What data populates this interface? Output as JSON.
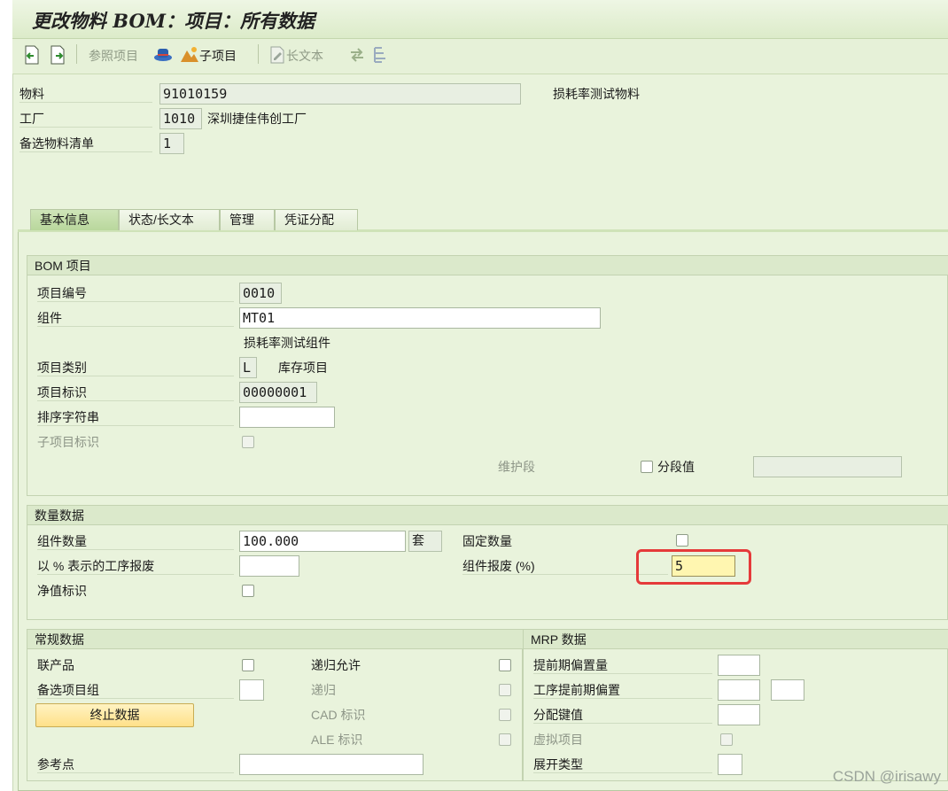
{
  "window": {
    "title": "更改物料 BOM：项目：所有数据"
  },
  "toolbar": {
    "ref_item": "参照项目",
    "sub_item": "子项目",
    "long_text": "长文本"
  },
  "header": {
    "material_label": "物料",
    "material_value": "91010159",
    "material_desc": "损耗率测试物料",
    "plant_label": "工厂",
    "plant_value": "1010",
    "plant_desc": "深圳捷佳伟创工厂",
    "alt_bom_label": "备选物料清单",
    "alt_bom_value": "1"
  },
  "tabs": [
    {
      "label": "基本信息",
      "active": true
    },
    {
      "label": "状态/长文本"
    },
    {
      "label": "管理"
    },
    {
      "label": "凭证分配"
    }
  ],
  "bom_item": {
    "title": "BOM 项目",
    "item_no_label": "项目编号",
    "item_no": "0010",
    "component_label": "组件",
    "component": "MT01",
    "component_desc": "损耗率测试组件",
    "item_cat_label": "项目类别",
    "item_cat": "L",
    "item_cat_desc": "库存项目",
    "item_id_label": "项目标识",
    "item_id": "00000001",
    "sort_label": "排序字符串",
    "sort_value": "",
    "sub_item_id_label": "子项目标识",
    "maint_label": "维护段",
    "segment_label": "分段值"
  },
  "qty_data": {
    "title": "数量数据",
    "comp_qty_label": "组件数量",
    "comp_qty": "100.000",
    "unit": "套",
    "fixed_qty_label": "固定数量",
    "op_scrap_label": "以 % 表示的工序报废",
    "op_scrap": "",
    "comp_scrap_label": "组件报废 (%)",
    "comp_scrap": "5",
    "net_label": "净值标识"
  },
  "general": {
    "title": "常规数据",
    "coproduct_label": "联产品",
    "alt_group_label": "备选项目组",
    "stop_button": "终止数据",
    "ref_point_label": "参考点",
    "recursive_allowed_label": "递归允许",
    "recursive_label": "递归",
    "cad_label": "CAD 标识",
    "ale_label": "ALE 标识"
  },
  "mrp": {
    "title": "MRP 数据",
    "lead_offset_label": "提前期偏置量",
    "op_lead_offset_label": "工序提前期偏置",
    "dist_key_label": "分配键值",
    "phantom_label": "虚拟项目",
    "explosion_label": "展开类型"
  },
  "watermark": "CSDN @irisawy",
  "colors": {
    "background": "#e9f3dc",
    "highlight_border": "#e53a3a",
    "button_fill": "#ffe089",
    "active_field": "#fff6b0"
  }
}
